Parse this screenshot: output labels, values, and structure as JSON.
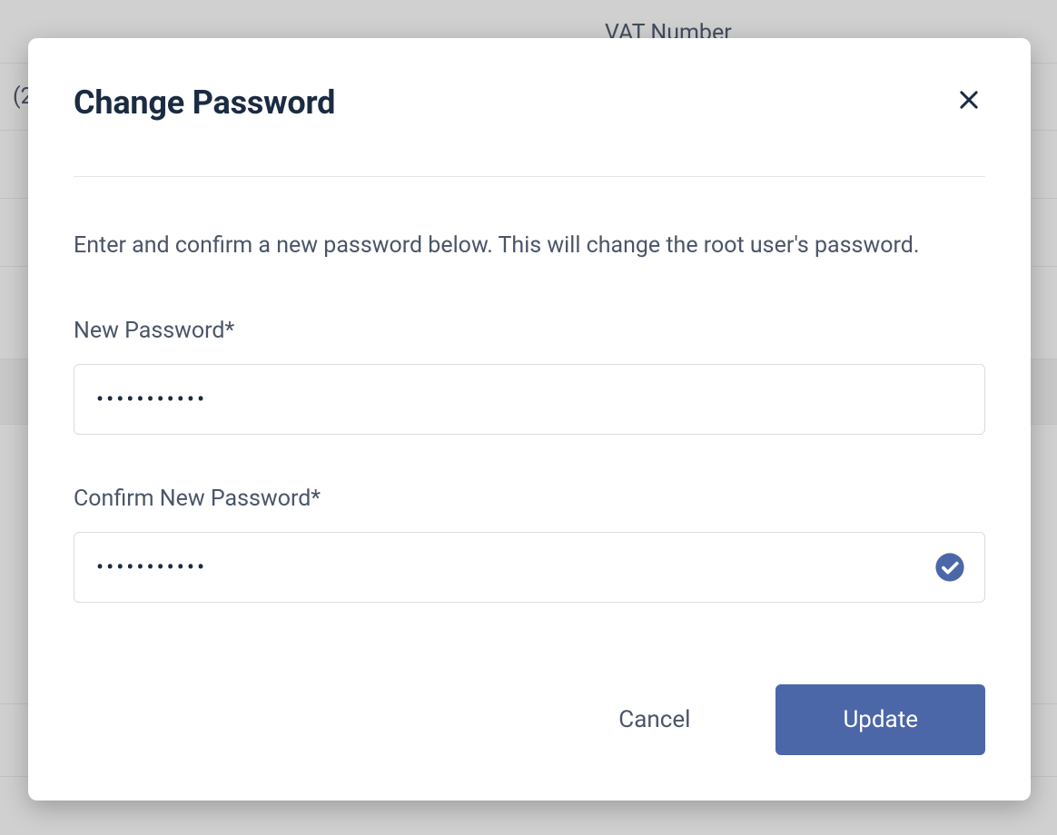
{
  "background": {
    "vat_label": "VAT Number",
    "partial_text": "(2"
  },
  "modal": {
    "title": "Change Password",
    "description": "Enter and confirm a new password below. This will change the root user's password.",
    "fields": {
      "new_password": {
        "label": "New Password*",
        "value": "•••••••••••"
      },
      "confirm_password": {
        "label": "Confirm New Password*",
        "value": "•••••••••••",
        "valid": true
      }
    },
    "actions": {
      "cancel_label": "Cancel",
      "submit_label": "Update"
    }
  }
}
